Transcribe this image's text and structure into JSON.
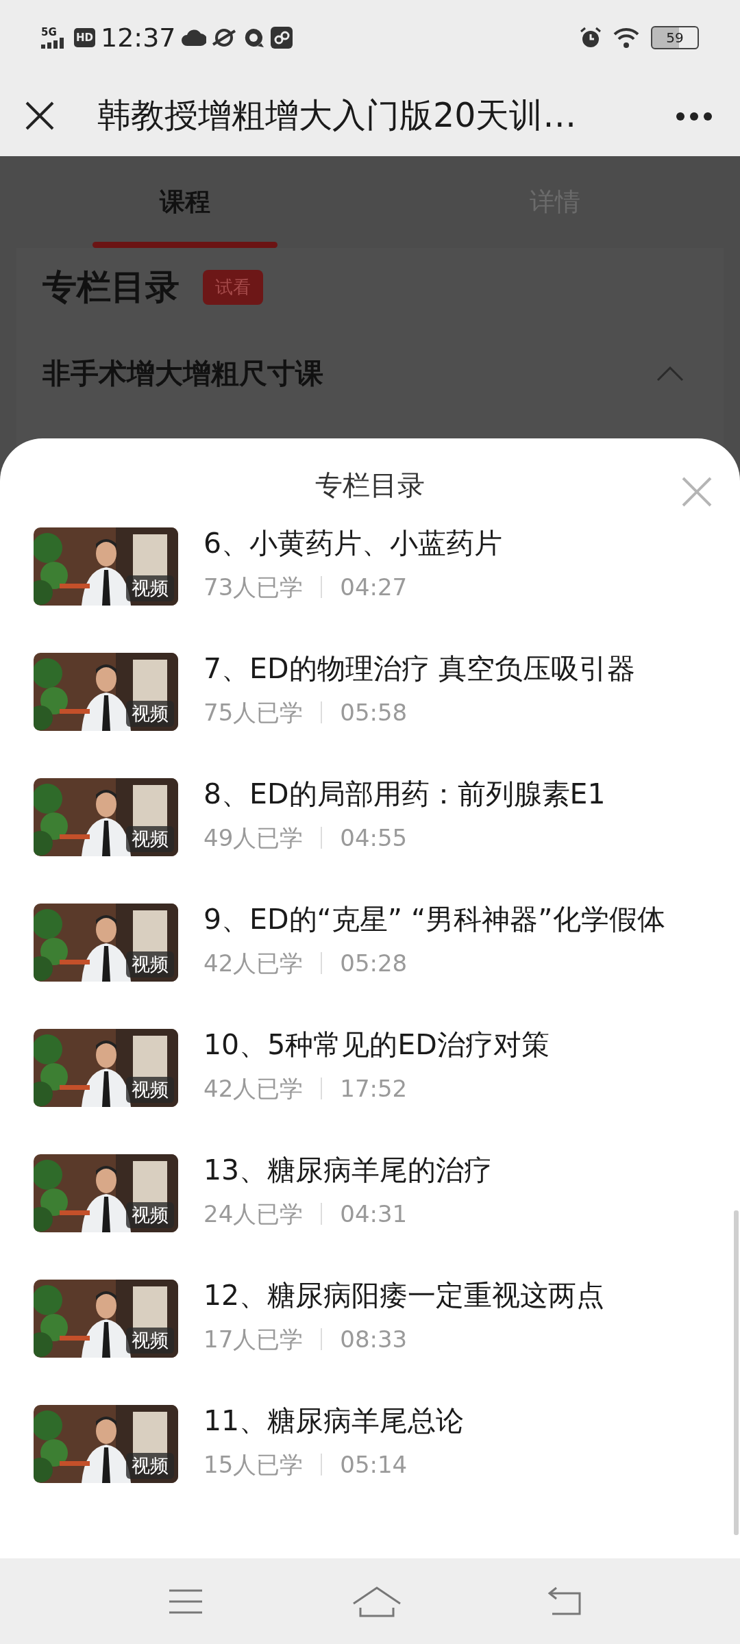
{
  "status_bar": {
    "network": "5G",
    "hd": "HD",
    "time": "12:37",
    "battery": "59"
  },
  "title_bar": {
    "title": "韩教授增粗增大入门版20天训…"
  },
  "tabs": [
    {
      "label": "课程",
      "selected": true
    },
    {
      "label": "详情",
      "selected": false
    }
  ],
  "section": {
    "heading": "专栏目录",
    "badge": "试看",
    "group": {
      "title": "非手术增大增粗尺寸课",
      "expanded": true
    }
  },
  "sheet": {
    "title": "专栏目录",
    "lessons": [
      {
        "title": "6、小黄药片、小蓝药片",
        "badge": "视频",
        "learners": "73人已学",
        "duration": "04:27"
      },
      {
        "title": "7、ED的物理治疗 真空负压吸引器",
        "badge": "视频",
        "learners": "75人已学",
        "duration": "05:58"
      },
      {
        "title": "8、ED的局部用药：前列腺素E1",
        "badge": "视频",
        "learners": "49人已学",
        "duration": "04:55"
      },
      {
        "title": "9、ED的“克星” “男科神器”化学假体",
        "badge": "视频",
        "learners": "42人已学",
        "duration": "05:28"
      },
      {
        "title": "10、5种常见的ED治疗对策",
        "badge": "视频",
        "learners": "42人已学",
        "duration": "17:52"
      },
      {
        "title": "13、糖尿病羊尾的治疗",
        "badge": "视频",
        "learners": "24人已学",
        "duration": "04:31"
      },
      {
        "title": "12、糖尿病阳痿一定重视这两点",
        "badge": "视频",
        "learners": "17人已学",
        "duration": "08:33"
      },
      {
        "title": "11、糖尿病羊尾总论",
        "badge": "视频",
        "learners": "15人已学",
        "duration": "05:14"
      }
    ]
  }
}
